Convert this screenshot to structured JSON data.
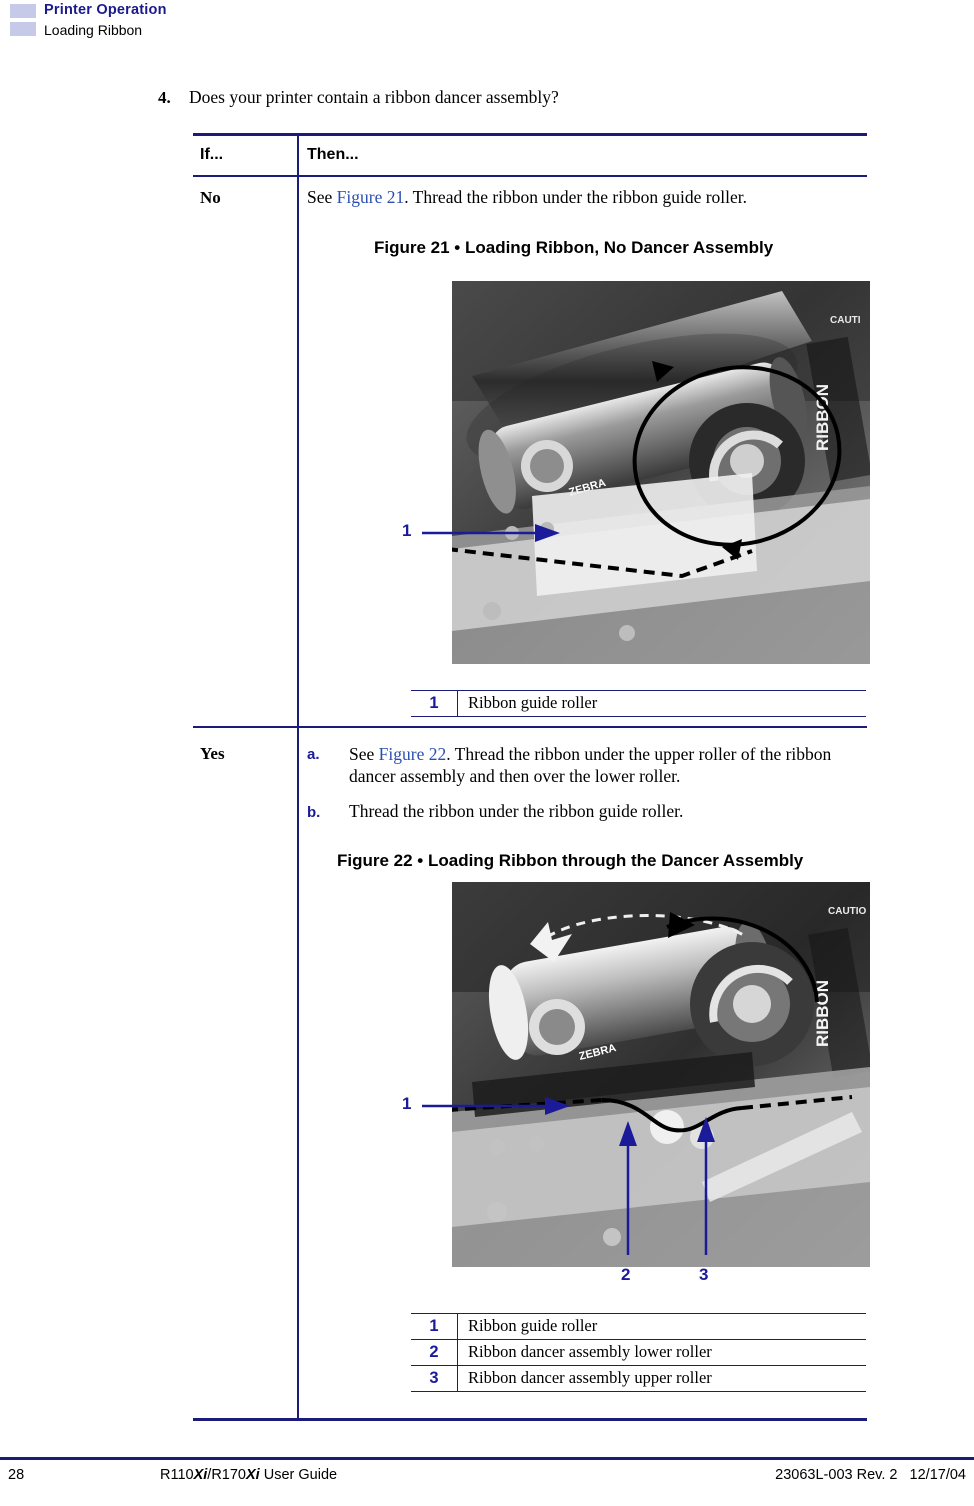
{
  "header": {
    "title": "Printer Operation",
    "subtitle": "Loading Ribbon"
  },
  "step": {
    "number": "4.",
    "text": "Does your printer contain a ribbon dancer assembly?"
  },
  "table": {
    "headers": {
      "if": "If...",
      "then": "Then..."
    },
    "rows": [
      {
        "label": "No",
        "text_prefix": "See ",
        "xref": "Figure 21",
        "text_suffix": ". Thread the ribbon under the ribbon guide roller.",
        "figure": {
          "title": "Figure 21 • Loading Ribbon, No Dancer Assembly",
          "callouts": [
            "1"
          ],
          "legend": [
            {
              "num": "1",
              "desc": "Ribbon guide roller"
            }
          ]
        }
      },
      {
        "label": "Yes",
        "substeps": [
          {
            "marker": "a.",
            "prefix": "See ",
            "xref": "Figure 22",
            "suffix": ". Thread the ribbon under the upper roller of the ribbon dancer assembly and then over the lower roller."
          },
          {
            "marker": "b.",
            "prefix": "",
            "xref": "",
            "suffix": "Thread the ribbon under the ribbon guide roller."
          }
        ],
        "figure": {
          "title": "Figure 22 • Loading Ribbon through the Dancer Assembly",
          "callouts": [
            "1",
            "2",
            "3"
          ],
          "legend": [
            {
              "num": "1",
              "desc": "Ribbon guide roller"
            },
            {
              "num": "2",
              "desc": "Ribbon dancer assembly lower roller"
            },
            {
              "num": "3",
              "desc": "Ribbon dancer assembly upper roller"
            }
          ]
        }
      }
    ]
  },
  "photo_labels": {
    "ribbon": "RIBBON",
    "caution": "CAUTION"
  },
  "footer": {
    "page": "28",
    "guide_pre": "R110",
    "guide_xi1": "Xi",
    "guide_mid": "/R170",
    "guide_xi2": "Xi",
    "guide_post": " User Guide",
    "docnum": "23063L-003 Rev. 2",
    "date": "12/17/04"
  },
  "colors": {
    "accent": "#1b1b7a",
    "xref": "#2a4fb0",
    "header_marker": "#c7c9e8"
  }
}
